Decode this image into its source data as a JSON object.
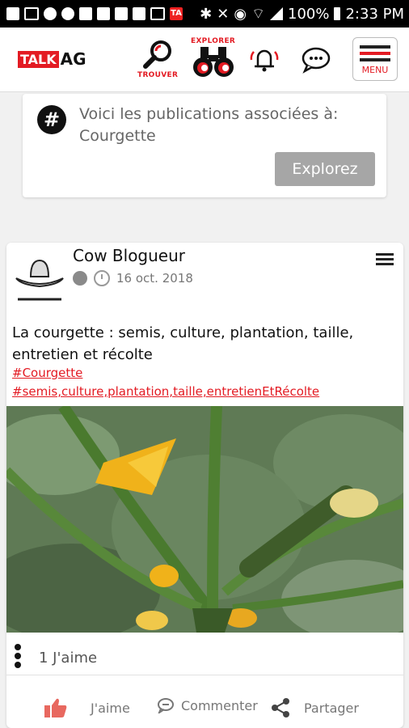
{
  "status_bar": {
    "battery": "100%",
    "time": "2:33 PM",
    "notif_badge": "TA"
  },
  "header": {
    "logo_talk": "TALK",
    "logo_ag": "AG",
    "trouver_label": "TROUVER",
    "explorer_label": "EXPLORER",
    "menu_label": "MENU"
  },
  "hashtag_card": {
    "text": "Voici les publications associées à: Courgette",
    "button": "Explorez"
  },
  "post": {
    "author": "Cow Blogueur",
    "date": "16 oct. 2018",
    "title": "La courgette : semis, culture, plantation, taille, entretien et récolte",
    "tags": [
      "#Courgette",
      "#semis,culture,plantation,taille,entretienEtRécolte"
    ],
    "likes": "1 J'aime",
    "actions": {
      "like": "J'aime",
      "comment": "Commenter",
      "share": "Partager"
    }
  },
  "colors": {
    "brand_red": "#e31b23",
    "button_gray": "#a6a6a6"
  }
}
